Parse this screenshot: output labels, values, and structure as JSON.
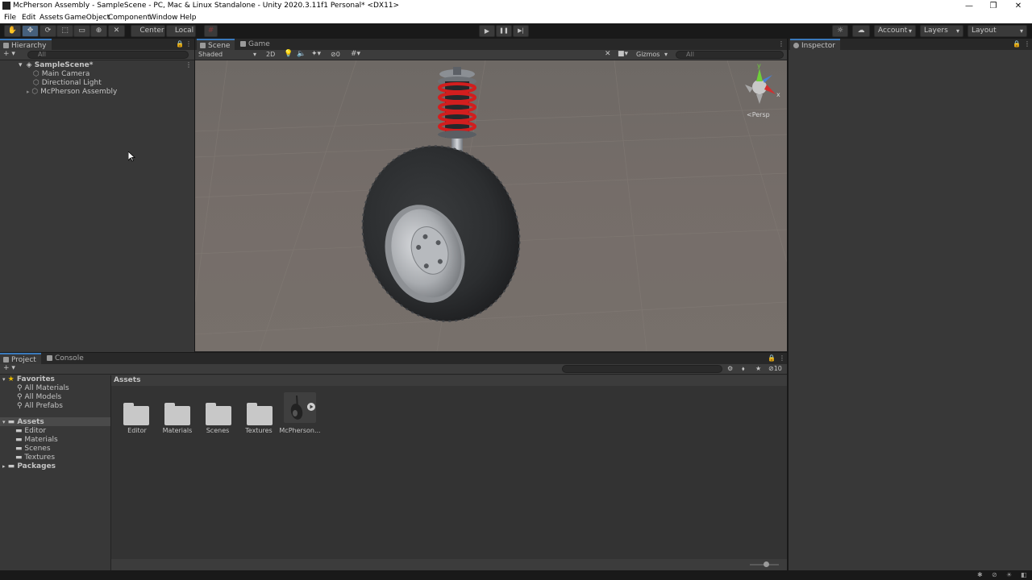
{
  "window": {
    "title": "McPherson Assembly - SampleScene - PC, Mac & Linux Standalone - Unity 2020.3.11f1 Personal* <DX11>",
    "controls": {
      "minimize": "—",
      "restore": "❐",
      "close": "✕"
    }
  },
  "menu": [
    "File",
    "Edit",
    "Assets",
    "GameObject",
    "Component",
    "Window",
    "Help"
  ],
  "toolbar": {
    "pivot_label": "Center",
    "space_label": "Local",
    "play_icon": "▶",
    "pause_icon": "❚❚",
    "step_icon": "▶|",
    "account_label": "Account",
    "layers_label": "Layers",
    "layout_label": "Layout"
  },
  "hierarchy": {
    "tab_label": "Hierarchy",
    "search_placeholder": "All",
    "add_label": "+ ▾",
    "scene_name": "SampleScene*",
    "items": [
      "Main Camera",
      "Directional Light",
      "McPherson Assembly"
    ]
  },
  "scene_view": {
    "tabs": [
      "Scene",
      "Game"
    ],
    "shading_mode": "Shaded",
    "mode_2d": "2D",
    "hidden_count": "0",
    "gizmos_label": "Gizmos",
    "search_placeholder": "All",
    "projection_label": "<Persp",
    "axis_labels": {
      "y": "y",
      "x": "x"
    }
  },
  "inspector": {
    "tab_label": "Inspector"
  },
  "project": {
    "tabs": [
      "Project",
      "Console"
    ],
    "add_label": "+ ▾",
    "hidden_count": "10",
    "favorites": {
      "label": "Favorites",
      "items": [
        "All Materials",
        "All Models",
        "All Prefabs"
      ]
    },
    "assets_root": {
      "label": "Assets",
      "items": [
        "Editor",
        "Materials",
        "Scenes",
        "Textures"
      ]
    },
    "packages_label": "Packages",
    "breadcrumb": "Assets",
    "grid_items": [
      "Editor",
      "Materials",
      "Scenes",
      "Textures",
      "McPherson..."
    ]
  },
  "colors": {
    "accent": "#3a79bb",
    "panel": "#383838",
    "dark": "#191919",
    "spring": "#d21e1e"
  }
}
